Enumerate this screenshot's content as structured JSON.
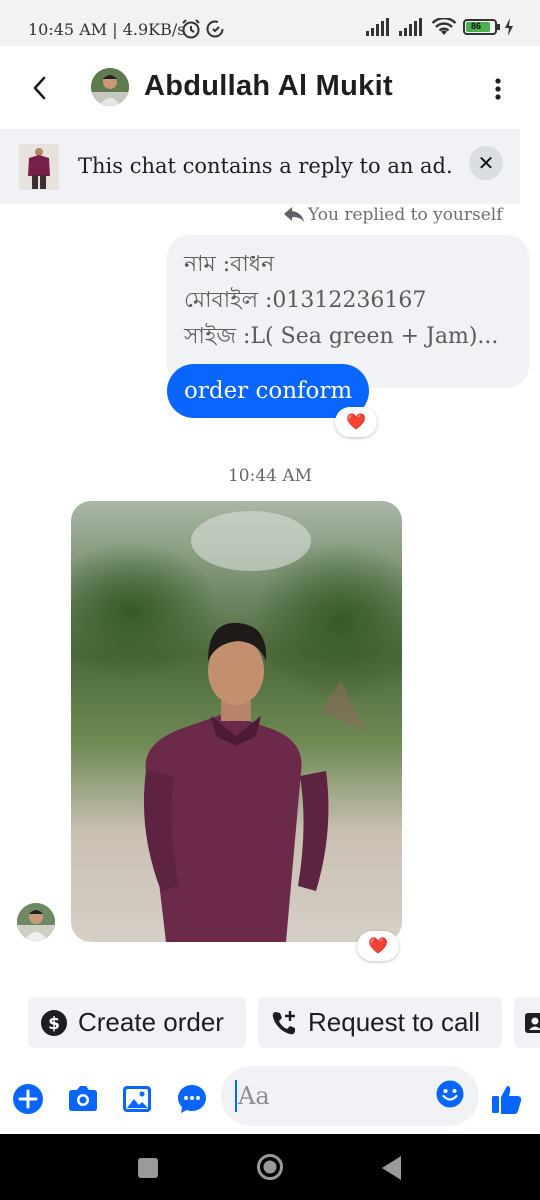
{
  "status_bar": {
    "time": "10:45 AM | 4.9KB/s",
    "battery": "86"
  },
  "header": {
    "contact_name": "Abdullah Al Mukit"
  },
  "ad_banner": {
    "text": "This chat contains a reply to an ad."
  },
  "messages": {
    "replied_note": "You replied to yourself",
    "quoted_lines": [
      "নাম :বাধন",
      "মোবাইল :01312236167",
      "সাইজ :L( Sea green + Jam)..."
    ],
    "order_text": "order conform",
    "reaction": "❤️",
    "timestamp": "10:44 AM"
  },
  "quick_actions": {
    "create_order": "Create order",
    "request_call": "Request to call"
  },
  "composer": {
    "placeholder": "Aa"
  },
  "colors": {
    "brand_blue": "#0866ff",
    "bubble_gray": "#f0f2f5"
  }
}
